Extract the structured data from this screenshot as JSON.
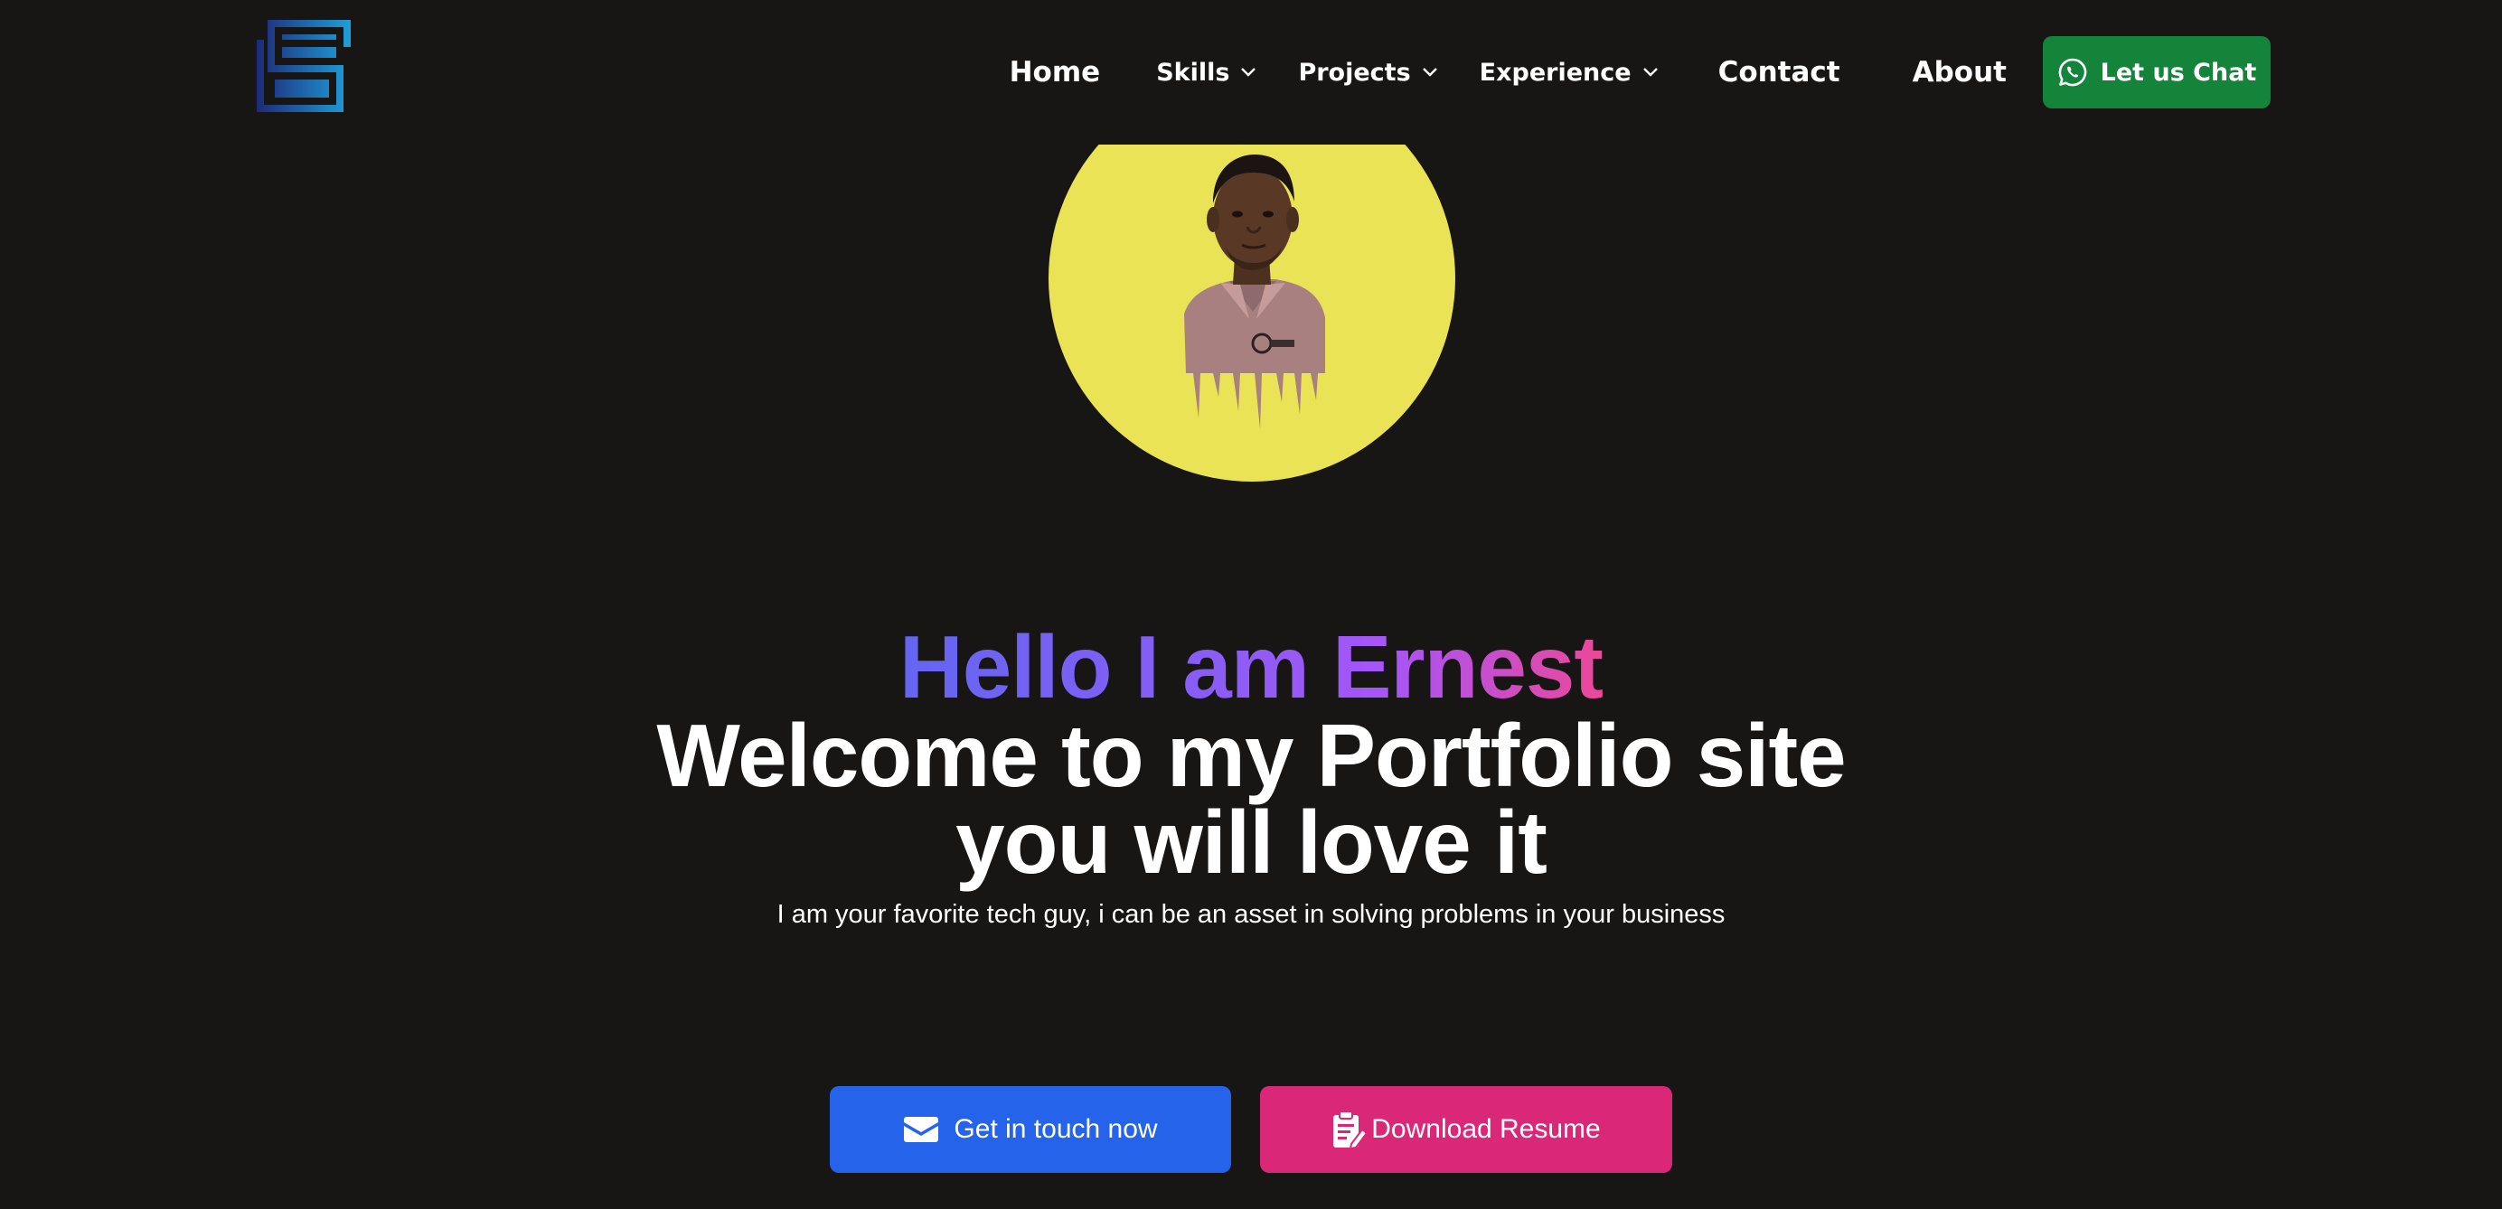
{
  "nav": {
    "logo_icon": "monogram-logo-icon",
    "items": [
      {
        "label": "Home",
        "has_dropdown": false
      },
      {
        "label": "Skills",
        "has_dropdown": true
      },
      {
        "label": "Projects",
        "has_dropdown": true
      },
      {
        "label": "Experience",
        "has_dropdown": true
      },
      {
        "label": "Contact",
        "has_dropdown": false
      },
      {
        "label": "About",
        "has_dropdown": false
      }
    ],
    "chat_button": {
      "label": "Let us Chat",
      "icon": "whatsapp-icon",
      "color": "#15843b"
    }
  },
  "hero": {
    "avatar": {
      "icon": "profile-portrait",
      "background": "#ebe356"
    },
    "greeting": "Hello I am Ernest",
    "headline_line1": "Welcome to my Portfolio site",
    "headline_line2": "you will love it",
    "subtitle": "I am your favorite tech guy, i can be an asset in solving problems in your business"
  },
  "cta": {
    "primary": {
      "label": "Get in touch now",
      "icon": "envelope-icon",
      "color": "#2563eb"
    },
    "secondary": {
      "label": "Download Resume",
      "icon": "resume-edit-icon",
      "color": "#db2777"
    }
  },
  "theme": {
    "background": "#171615",
    "gradient": [
      "#6366f1",
      "#8b5cf6",
      "#a855f7",
      "#ec4899"
    ]
  }
}
